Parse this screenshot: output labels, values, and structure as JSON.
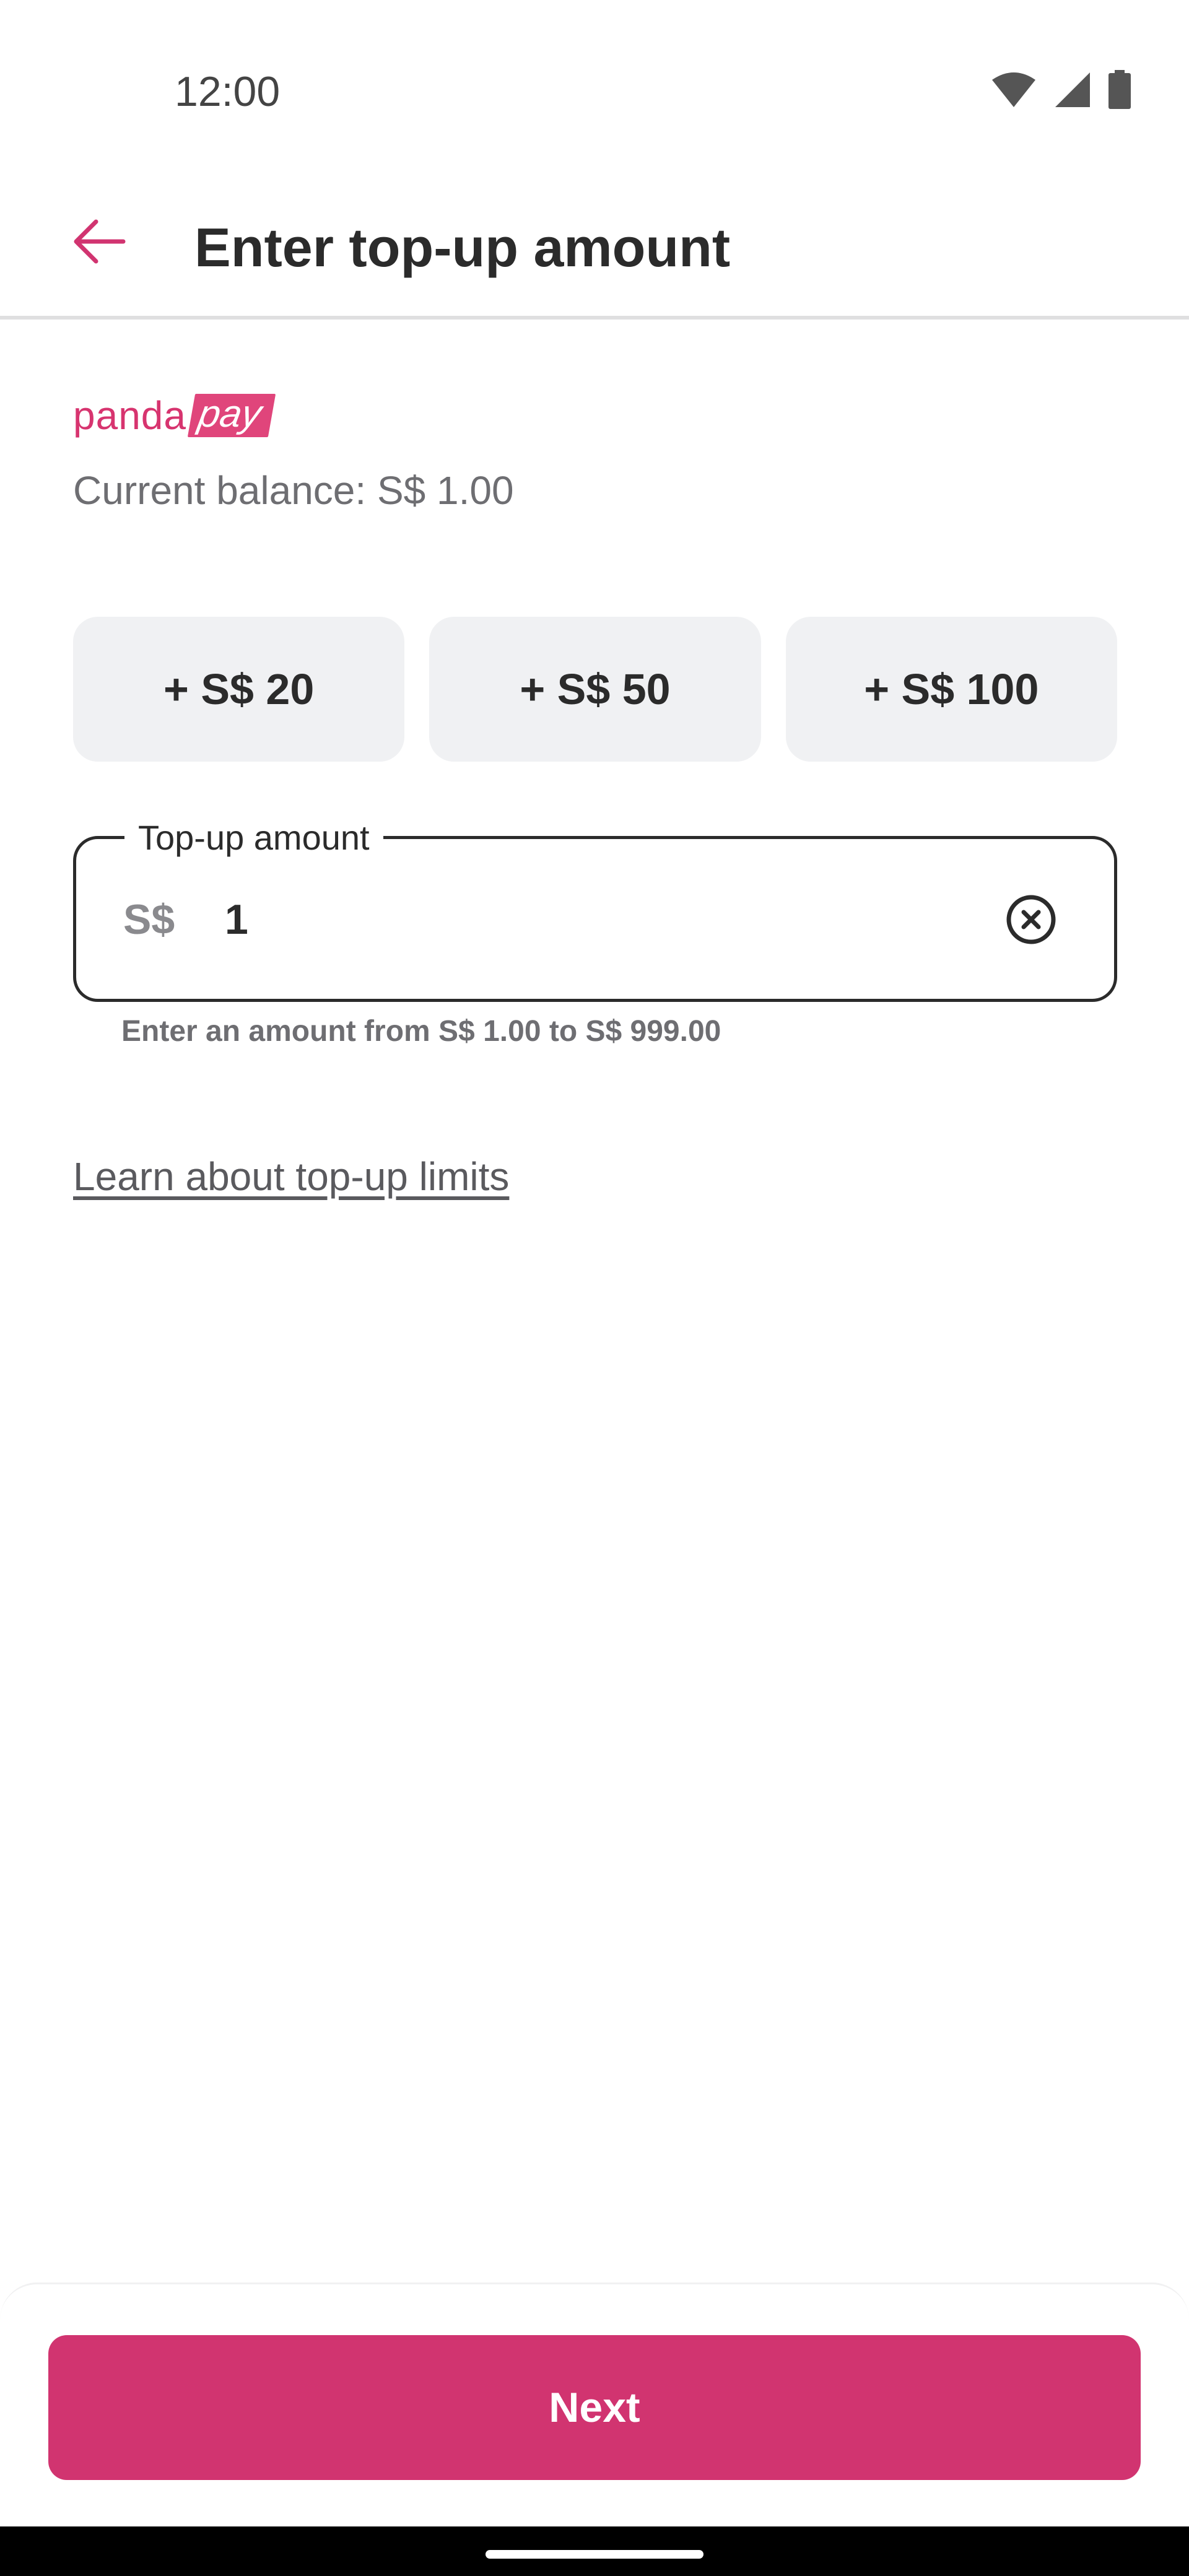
{
  "status_bar": {
    "time": "12:00",
    "icons": [
      "wifi-icon",
      "signal-icon",
      "battery-icon"
    ]
  },
  "header": {
    "back_icon": "arrow-left-icon",
    "title": "Enter top-up amount"
  },
  "brand": {
    "logo_part1": "panda",
    "logo_part2": "pay",
    "color": "#d7346f"
  },
  "balance": {
    "text": "Current balance: S$ 1.00"
  },
  "quick_amounts": [
    {
      "label": "+ S$ 20"
    },
    {
      "label": "+ S$ 50"
    },
    {
      "label": "+ S$ 100"
    }
  ],
  "amount_input": {
    "label": "Top-up amount",
    "currency": "S$",
    "value": "1",
    "clear_icon": "clear-circle-icon",
    "helper": "Enter an amount from S$ 1.00 to S$ 999.00"
  },
  "limits_link": {
    "text": "Learn about top-up limits"
  },
  "footer": {
    "next_label": "Next",
    "accent_color": "#d13470"
  }
}
